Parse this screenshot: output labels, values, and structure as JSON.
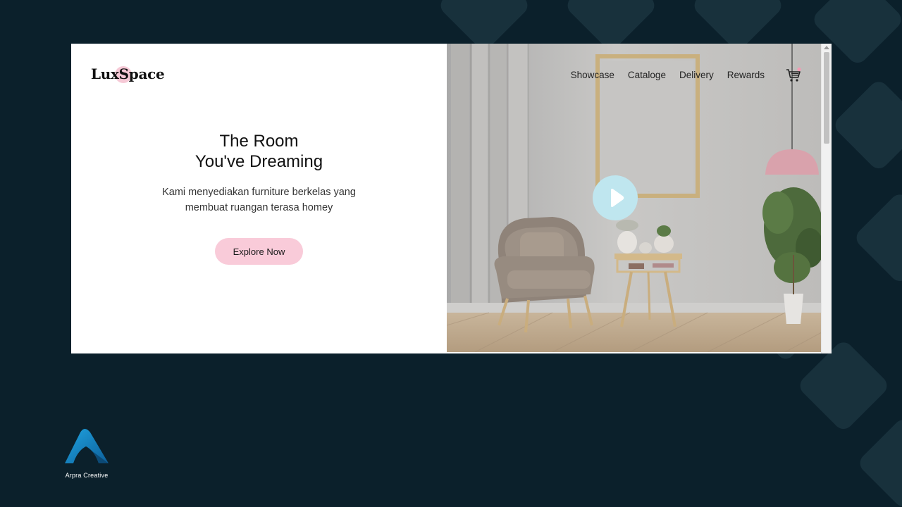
{
  "site": {
    "logo": "LuxSpace",
    "nav": [
      "Showcase",
      "Cataloge",
      "Delivery",
      "Rewards"
    ],
    "cart_icon": "shopping-cart-icon",
    "hero": {
      "title_line1": "The Room",
      "title_line2": "You've Dreaming",
      "subtitle_line1": "Kami menyediakan furniture berkelas yang",
      "subtitle_line2": "membuat ruangan terasa homey",
      "cta_label": "Explore Now"
    },
    "video": {
      "play_icon": "play-icon"
    }
  },
  "brand": {
    "name": "Arpra Creative"
  },
  "colors": {
    "background": "#0b202b",
    "accent_pink": "#f9cbd9",
    "play_button": "#bfe6ef"
  }
}
